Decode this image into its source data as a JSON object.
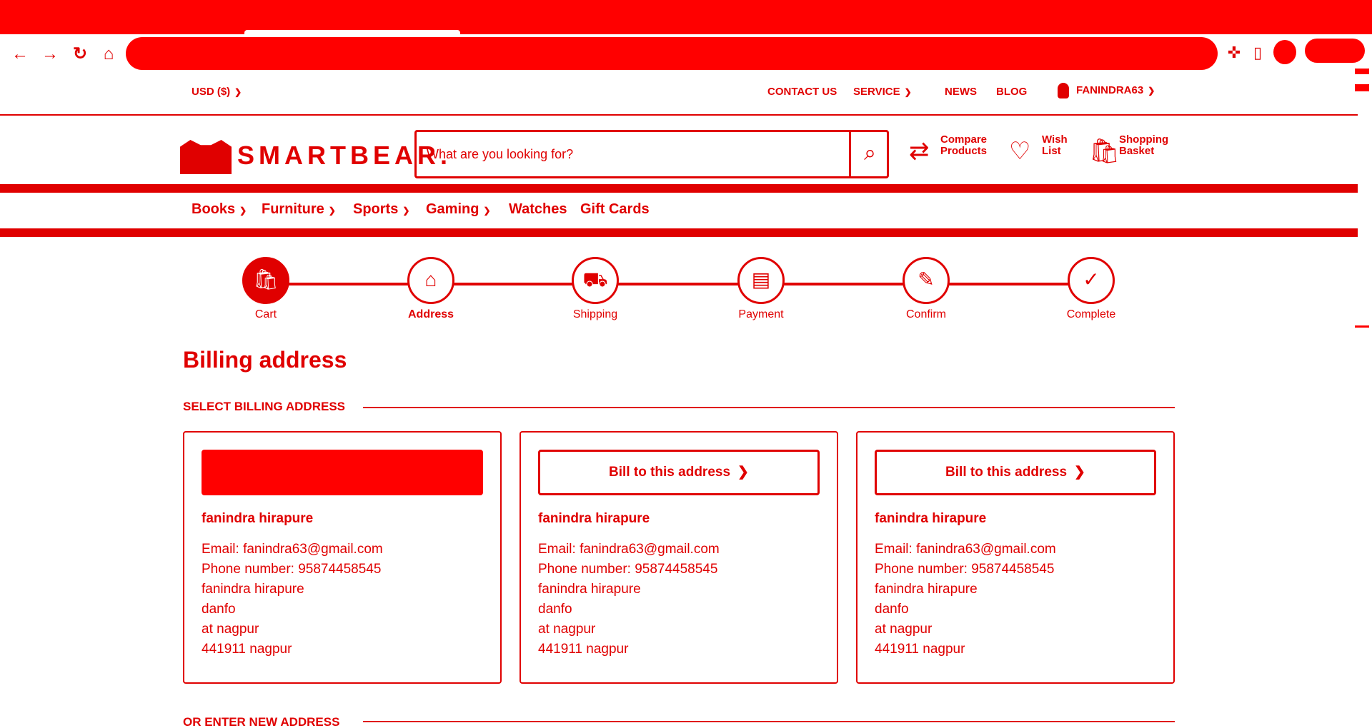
{
  "browser": {
    "nav_icons": [
      "back-icon",
      "forward-icon",
      "reload-icon",
      "home-icon"
    ],
    "extension_icons": [
      "puzzle-icon",
      "sidepanel-icon"
    ]
  },
  "topbar": {
    "currency": "USD ($)",
    "contact": "CONTACT US",
    "service": "SERVICE",
    "news": "NEWS",
    "blog": "BLOG",
    "username": "FANINDRA63"
  },
  "header": {
    "logo_text": "SMARTBEAR.",
    "search_placeholder": "What are you looking for?",
    "compare_label": "Compare Products",
    "wishlist_label": "Wish List",
    "basket_label": "Shopping Basket"
  },
  "categories": [
    "Books",
    "Furniture",
    "Sports",
    "Gaming",
    "Watches",
    "Gift Cards"
  ],
  "steps": [
    {
      "label": "Cart",
      "icon": "cart-icon",
      "glyph": "🛍"
    },
    {
      "label": "Address",
      "icon": "home-icon",
      "glyph": "⌂"
    },
    {
      "label": "Shipping",
      "icon": "truck-icon",
      "glyph": "⛟"
    },
    {
      "label": "Payment",
      "icon": "card-icon",
      "glyph": "▤"
    },
    {
      "label": "Confirm",
      "icon": "thumbs-up-icon",
      "glyph": "✎"
    },
    {
      "label": "Complete",
      "icon": "check-icon",
      "glyph": "✓"
    }
  ],
  "page_title": "Billing address",
  "select_heading": "SELECT BILLING ADDRESS",
  "new_address_heading": "OR ENTER NEW ADDRESS",
  "addresses": [
    {
      "button": "",
      "name": "fanindra hirapure",
      "email": "Email: fanindra63@gmail.com",
      "phone": "Phone number: 95874458545",
      "line1": "fanindra hirapure",
      "line2": "danfo",
      "line3": "at nagpur",
      "line4": "441911 nagpur"
    },
    {
      "button": "Bill to this address",
      "name": "fanindra hirapure",
      "email": "Email: fanindra63@gmail.com",
      "phone": "Phone number: 95874458545",
      "line1": "fanindra hirapure",
      "line2": "danfo",
      "line3": "at nagpur",
      "line4": "441911 nagpur"
    },
    {
      "button": "Bill to this address",
      "name": "fanindra hirapure",
      "email": "Email: fanindra63@gmail.com",
      "phone": "Phone number: 95874458545",
      "line1": "fanindra hirapure",
      "line2": "danfo",
      "line3": "at nagpur",
      "line4": "441911 nagpur"
    }
  ],
  "colors": {
    "accent": "#e00000",
    "chrome": "#ff0000"
  }
}
